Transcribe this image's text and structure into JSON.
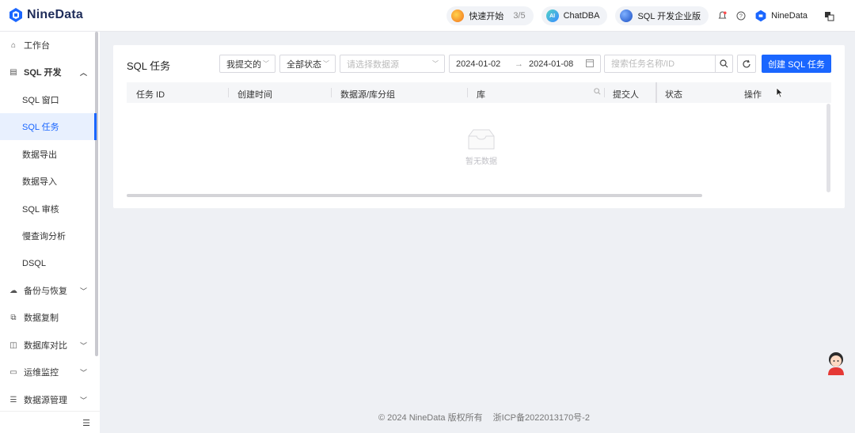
{
  "brand": {
    "name": "NineData",
    "color": "#1a66ff"
  },
  "topbar": {
    "quick_start": {
      "label": "快速开始",
      "progress": "3/5"
    },
    "chatdba": {
      "label": "ChatDBA",
      "icon_text": "AI"
    },
    "edition": {
      "label": "SQL 开发企业版"
    },
    "user": {
      "name": "NineData"
    }
  },
  "sidebar": {
    "workbench": "工作台",
    "sql_dev": "SQL 开发",
    "sql_window": "SQL 窗口",
    "sql_task": "SQL 任务",
    "data_export": "数据导出",
    "data_import": "数据导入",
    "sql_review": "SQL 审核",
    "slow_query": "慢查询分析",
    "dsql": "DSQL",
    "backup": "备份与恢复",
    "replication": "数据复制",
    "compare": "数据库对比",
    "monitor": "运维监控",
    "datasource": "数据源管理"
  },
  "main": {
    "title": "SQL 任务",
    "filters": {
      "submitter": "我提交的",
      "status": "全部状态",
      "datasource_placeholder": "请选择数据源",
      "date_start": "2024-01-02",
      "date_arrow": "→",
      "date_end": "2024-01-08",
      "search_placeholder": "搜索任务名称/ID"
    },
    "create_button": "创建 SQL 任务",
    "columns": [
      "任务 ID",
      "创建时间",
      "数据源/库分组",
      "库",
      "提交人",
      "状态",
      "操作"
    ],
    "empty_text": "暂无数据"
  },
  "footer": {
    "copyright": "© 2024 NineData 版权所有",
    "icp": "浙ICP备2022013170号-2"
  }
}
